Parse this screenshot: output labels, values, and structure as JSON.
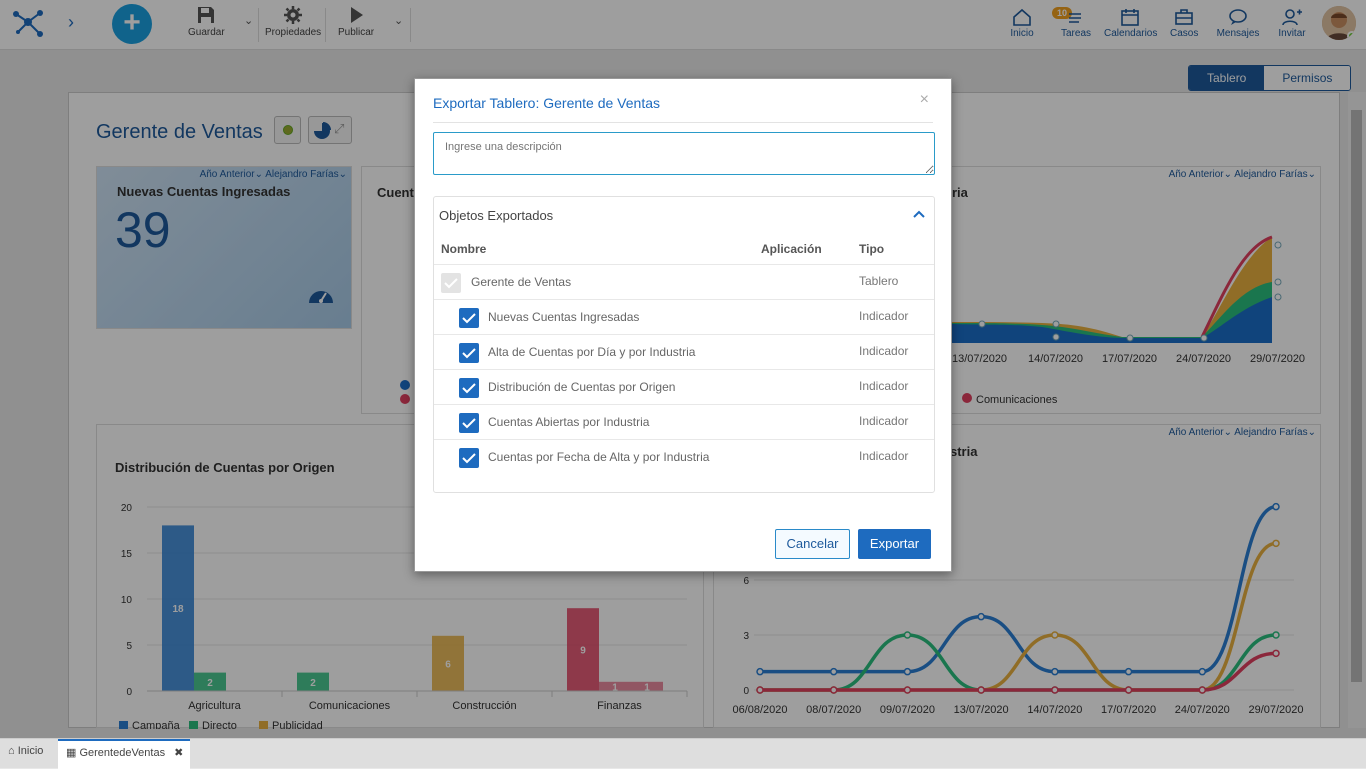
{
  "topbar": {
    "save_label": "Guardar",
    "properties_label": "Propiedades",
    "publish_label": "Publicar",
    "nav": [
      {
        "label": "Inicio",
        "icon": "home-icon"
      },
      {
        "label": "Tareas",
        "icon": "tasks-icon",
        "badge": "10"
      },
      {
        "label": "Calendarios",
        "icon": "calendar-icon"
      },
      {
        "label": "Casos",
        "icon": "briefcase-icon"
      },
      {
        "label": "Mensajes",
        "icon": "message-icon"
      },
      {
        "label": "Invitar",
        "icon": "invite-icon"
      }
    ]
  },
  "view_toggle": {
    "dashboard": "Tablero",
    "permissions": "Permisos"
  },
  "dashboard": {
    "title": "Gerente de Ventas",
    "kpi": {
      "title": "Nuevas Cuentas Ingresadas",
      "value": "39",
      "filter_period": "Año Anterior",
      "filter_user": "Alejandro Farías"
    },
    "card2": {
      "title_fragment": "Cuent",
      "right_title_fragment": "ria",
      "filter_period": "Año Anterior",
      "filter_user": "Alejandro Farías",
      "legend_visible": "Comunicaciones"
    },
    "card3": {
      "title": "Distribución de Cuentas por Origen"
    },
    "card4": {
      "title_fragment": "stria",
      "filter_period": "Año Anterior",
      "filter_user": "Alejandro Farías"
    }
  },
  "chart_data": [
    {
      "type": "bar",
      "title": "Distribución de Cuentas por Origen",
      "categories": [
        "Agricultura",
        "Comunicaciones",
        "Construcción",
        "Finanzas"
      ],
      "series": [
        {
          "name": "Campaña",
          "color": "#2a7fd4",
          "values": [
            18,
            0,
            0,
            0
          ]
        },
        {
          "name": "Directo",
          "color": "#2bbf7f",
          "values": [
            2,
            2,
            0,
            0
          ]
        },
        {
          "name": "Publicidad",
          "color": "#e8b040",
          "values": [
            0,
            0,
            6,
            0
          ]
        },
        {
          "name": "",
          "color": "#e04060",
          "values": [
            0,
            0,
            0,
            9
          ]
        },
        {
          "name": "",
          "color": "#e87890",
          "values": [
            0,
            0,
            0,
            1
          ]
        },
        {
          "name": "",
          "color": "#e87890",
          "values": [
            0,
            0,
            0,
            1
          ]
        }
      ],
      "ylim": [
        0,
        20
      ],
      "yticks": [
        "0",
        "5",
        "10",
        "15",
        "20"
      ]
    },
    {
      "type": "line",
      "x": [
        "06/08/2020",
        "08/07/2020",
        "09/07/2020",
        "13/07/2020",
        "14/07/2020",
        "17/07/2020",
        "24/07/2020",
        "29/07/2020"
      ],
      "yticks": [
        "0",
        "3",
        "6"
      ],
      "ylim": [
        0,
        9
      ],
      "series": [
        {
          "color": "#2a7fd4",
          "values": [
            1,
            1,
            1,
            4,
            1,
            1,
            1,
            10
          ]
        },
        {
          "color": "#2bbf7f",
          "values": [
            0,
            0,
            3,
            0,
            0,
            0,
            0,
            3
          ]
        },
        {
          "color": "#e8b040",
          "values": [
            0,
            0,
            0,
            0,
            3,
            0,
            0,
            8
          ]
        },
        {
          "color": "#e04060",
          "values": [
            0,
            0,
            0,
            0,
            0,
            0,
            0,
            2
          ]
        }
      ]
    },
    {
      "type": "area",
      "x": [
        "13/07/2020",
        "14/07/2020",
        "17/07/2020",
        "24/07/2020",
        "29/07/2020"
      ]
    }
  ],
  "modal": {
    "title": "Exportar Tablero: Gerente de Ventas",
    "close": "×",
    "description_placeholder": "Ingrese una descripción",
    "panel_title": "Objetos Exportados",
    "columns": {
      "name": "Nombre",
      "app": "Aplicación",
      "type": "Tipo"
    },
    "rows": [
      {
        "name": "Gerente de Ventas",
        "type": "Tablero"
      },
      {
        "name": "Nuevas Cuentas Ingresadas",
        "type": "Indicador"
      },
      {
        "name": "Alta de Cuentas por Día y por Industria",
        "type": "Indicador"
      },
      {
        "name": "Distribución de Cuentas por Origen",
        "type": "Indicador"
      },
      {
        "name": "Cuentas Abiertas por Industria",
        "type": "Indicador"
      },
      {
        "name": "Cuentas por Fecha de Alta y por Industria",
        "type": "Indicador"
      }
    ],
    "cancel_label": "Cancelar",
    "export_label": "Exportar"
  },
  "tabs": [
    {
      "label": "Inicio"
    },
    {
      "label": "GerentedeVentas",
      "close": "✖"
    }
  ]
}
